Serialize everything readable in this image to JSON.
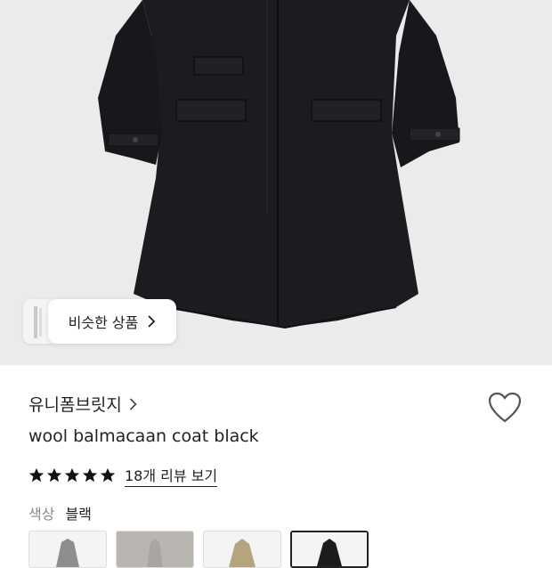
{
  "hero": {
    "similar_label": "비슷한 상품"
  },
  "product": {
    "brand": "유니폼브릿지",
    "title": "wool balmacaan coat black",
    "rating_stars": 5,
    "reviews_label": "18개 리뷰 보기",
    "color_label": "색상",
    "color_value": "블랙"
  },
  "swatches": [
    {
      "color": "#8d8d8d"
    },
    {
      "color": "#b9b6b2"
    },
    {
      "color": "#b5a47d"
    },
    {
      "color": "#1d1d1f",
      "selected": true
    }
  ],
  "colors": {
    "coat": "#1b1c1f",
    "hero_bg": "#ebebeb"
  }
}
